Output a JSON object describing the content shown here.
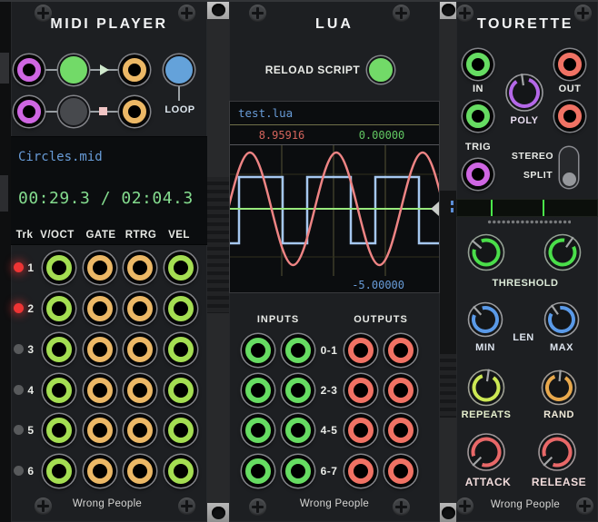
{
  "colors": {
    "panel": "#1d1f22",
    "display_bg": "#0b0d0f",
    "file_text": "#689cd8",
    "time_text": "#84dc8e",
    "value_red": "#d4645c",
    "value_green": "#62c862",
    "value_blue": "#689cd8",
    "sine_wave": "#ee8484",
    "square_wave": "#a6c8f0",
    "zero_line": "#98e87c",
    "port_purple": "#cf66e2",
    "port_orange": "#ecb866",
    "port_yellow_green": "#a4de52",
    "port_green": "#66dc62",
    "port_red": "#f07264",
    "button_green": "#72da68",
    "button_blue": "#64a2da",
    "knob_green": "#4ade4a",
    "knob_blue": "#5a9ae8",
    "knob_yellow_green": "#cce854",
    "knob_orange": "#e8a84c",
    "knob_red": "#e86868",
    "knob_purple": "#b468e8",
    "led_red": "#ee3434"
  },
  "midi_player": {
    "title": "MIDI PLAYER",
    "loop_label": "LOOP",
    "file_name": "Circles.mid",
    "time_display": "00:29.3 / 02:04.3",
    "table": {
      "headers": [
        "Trk",
        "V/OCT",
        "GATE",
        "RTRG",
        "VEL"
      ]
    },
    "tracks": [
      {
        "num": "1",
        "led": "on"
      },
      {
        "num": "2",
        "led": "on"
      },
      {
        "num": "3",
        "led": "off"
      },
      {
        "num": "4",
        "led": "off"
      },
      {
        "num": "5",
        "led": "off"
      },
      {
        "num": "6",
        "led": "off"
      }
    ],
    "brand": "Wrong People"
  },
  "lua": {
    "title": "LUA",
    "reload_label": "RELOAD SCRIPT",
    "script_name": "test.lua",
    "scope": {
      "value_top_left": "8.95916",
      "value_top_right": "0.00000",
      "value_bottom_right": "-5.00000"
    },
    "inputs_label": "INPUTS",
    "outputs_label": "OUTPUTS",
    "io_rows": [
      "0-1",
      "2-3",
      "4-5",
      "6-7"
    ],
    "brand": "Wrong People"
  },
  "tourette": {
    "title": "TOURETTE",
    "in_label": "IN",
    "out_label": "OUT",
    "poly_label": "POLY",
    "trig_label": "TRIG",
    "stereo_label": "STEREO",
    "split_label": "SPLIT",
    "threshold_label": "THRESHOLD",
    "len_label": "LEN",
    "min_label": "MIN",
    "max_label": "MAX",
    "repeats_label": "REPEATS",
    "rand_label": "RAND",
    "attack_label": "ATTACK",
    "release_label": "RELEASE",
    "brand": "Wrong People"
  }
}
